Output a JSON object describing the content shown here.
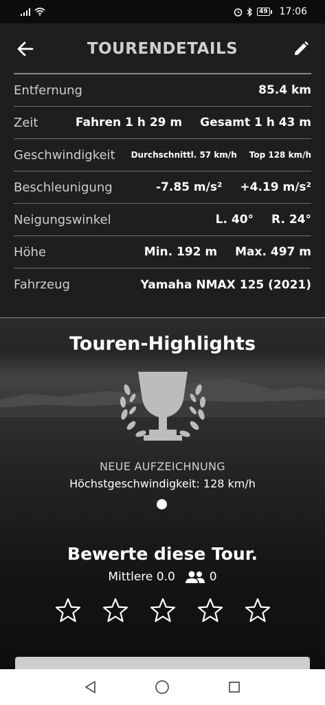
{
  "status_bar": {
    "time": "17:06",
    "battery": "49",
    "icons": [
      "signal-icon",
      "wifi-icon",
      "alarm-icon",
      "bluetooth-icon",
      "battery-icon"
    ]
  },
  "header": {
    "title": "TOURENDETAILS",
    "back_icon": "arrow-left-icon",
    "edit_icon": "pencil-icon"
  },
  "details": [
    {
      "label": "Entfernung",
      "values": [
        "85.4 km"
      ]
    },
    {
      "label": "Zeit",
      "values": [
        "Fahren 1 h 29 m",
        "Gesamt 1 h 43 m"
      ]
    },
    {
      "label": "Geschwindigkeit",
      "values": [
        "Durchschnittl. 57 km/h",
        "Top 128 km/h"
      ]
    },
    {
      "label": "Beschleunigung",
      "values": [
        "-7.85 m/s²",
        "+4.19 m/s²"
      ]
    },
    {
      "label": "Neigungswinkel",
      "values": [
        "L. 40°",
        "R. 24°"
      ]
    },
    {
      "label": "Höhe",
      "values": [
        "Min. 192 m",
        "Max. 497 m"
      ]
    },
    {
      "label": "Fahrzeug",
      "values": [
        "Yamaha NMAX 125 (2021)"
      ]
    }
  ],
  "highlights": {
    "title": "Touren-Highlights",
    "icon": "trophy-icon",
    "record_label": "NEUE AUFZEICHNUNG",
    "record_value": "Höchstgeschwindigkeit: 128 km/h"
  },
  "rating": {
    "title": "Bewerte diese Tour.",
    "average": "Mittlere 0.0",
    "count": "0",
    "stars": 0,
    "max_stars": 5
  },
  "colors": {
    "header_bg": "#1e1e1e",
    "title_gray": "#cfcfcf",
    "accent_white": "#ffffff",
    "button_gray": "#cdcdcd"
  }
}
